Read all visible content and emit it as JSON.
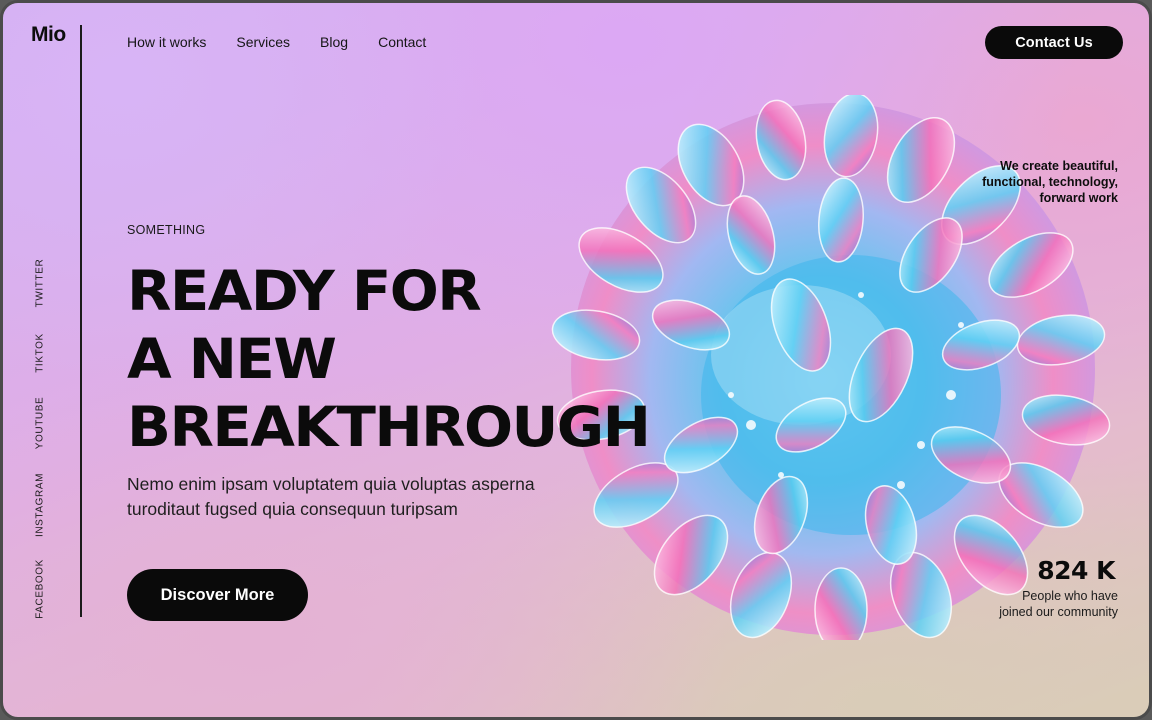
{
  "brand": {
    "logo": "Mio"
  },
  "nav": {
    "items": [
      "How it works",
      "Services",
      "Blog",
      "Contact"
    ],
    "cta": "Contact Us"
  },
  "social": [
    "TWITTER",
    "TIKTOK",
    "YOUTUBE",
    "INSTAGRAM",
    "FACEBOOK"
  ],
  "hero": {
    "eyebrow": "SOMETHING",
    "headline": [
      "READY FOR",
      "A NEW",
      "BREAKTHROUGH"
    ],
    "description": [
      "Nemo enim ipsam voluptatem quia voluptas asperna",
      "turoditaut fugsed quia consequun turipsam"
    ],
    "cta": "Discover More"
  },
  "tagline": [
    "We create beautiful,",
    "functional, technology,",
    "forward work"
  ],
  "stat": {
    "value": "824 K",
    "label": [
      "People who have",
      "joined our community"
    ]
  },
  "colors": {
    "accent": "#0a0a0a",
    "background_start": "#d3b0f2",
    "background_end": "#dacdb7"
  }
}
